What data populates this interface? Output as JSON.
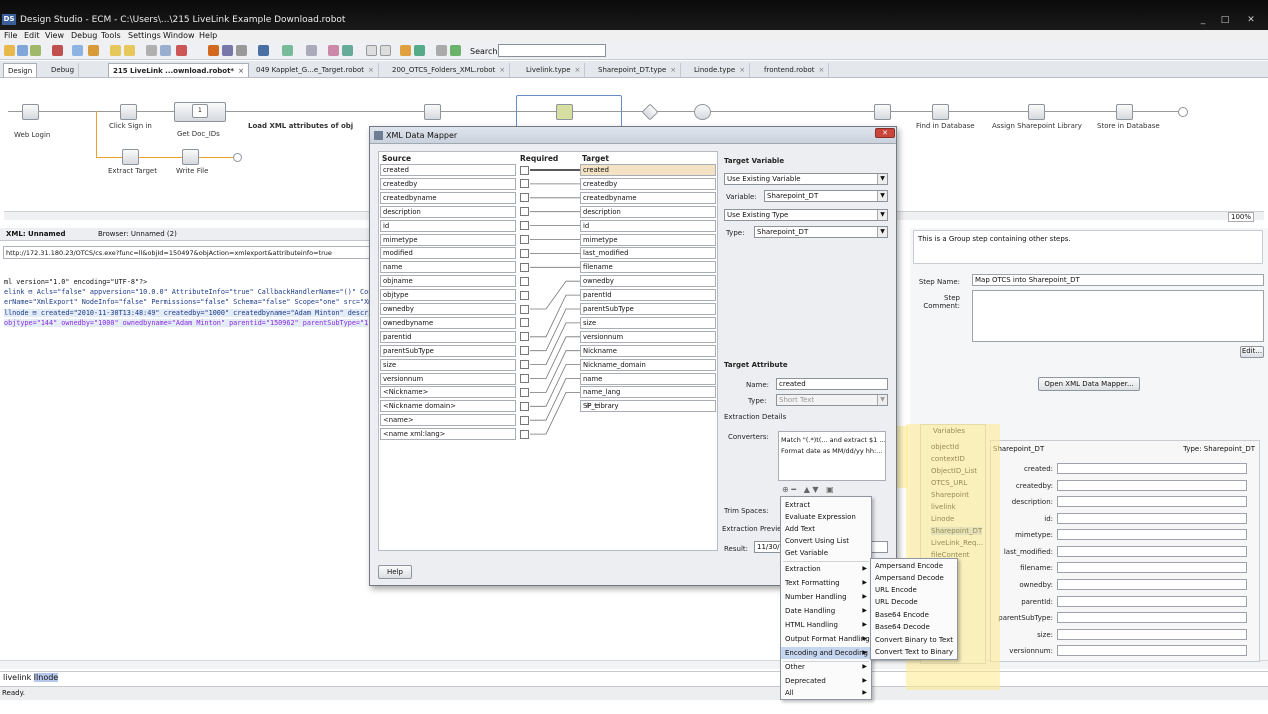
{
  "window": {
    "title": "Design Studio - ECM - C:\\Users\\...\\215 LiveLink Example Download.robot",
    "logo": "DS"
  },
  "menu": [
    "File",
    "Edit",
    "View",
    "Debug",
    "Tools",
    "Settings",
    "Window",
    "Help"
  ],
  "toolbar": {
    "search_label": "Search:",
    "search_value": ""
  },
  "tabs": {
    "mode": [
      "Design",
      "Debug"
    ],
    "docs": [
      "215 LiveLink ...ownload.robot*",
      "049 Kapplet_G...e_Target.robot",
      "200_OTCS_Folders_XML.robot",
      "Livelink.type",
      "Sharepoint_DT.type",
      "Linode.type",
      "frontend.robot"
    ]
  },
  "flow": {
    "nodes": [
      "Web Login",
      "Click Sign in",
      "Get Doc_IDs",
      "Load XML attributes of obj",
      "Find in Database",
      "Assign Sharepoint Library",
      "Store in Database",
      "Extract Target",
      "Write File"
    ],
    "loop_count": "1"
  },
  "zoom": "100%",
  "left_pane": {
    "tabs": [
      "XML: Unnamed",
      "Browser: Unnamed (2)"
    ],
    "url": "http://172.31.180.23/OTCS/cs.exe?func=ll&objId=150497&objAction=xmlexport&attributeinfo=true",
    "xml_lines": [
      "ml version=\"1.0\" encoding=\"UTF-8\"?>",
      "elink ⊟ Acls=\"false\" appversion=\"10.0.0\" AttributeInfo=\"true\" CallbackHandlerName=\"()\" ContentInline",
      "erName=\"XmlExport\" NodeInfo=\"false\" Permissions=\"false\" Schema=\"false\" Scope=\"one\" src=\"XmlE",
      "llnode ⊟ created=\"2010-11-30T13:48:49\" createdby=\"1000\" createdbyname=\"Adam Minton\" descripti",
      "objtype=\"144\" ownedby=\"1000\" ownedbyname=\"Adam Minton\" parentid=\"150962\" parentSubType=\"1"
    ],
    "path": [
      "livelink",
      "llnode"
    ]
  },
  "status": "Ready.",
  "dialog": {
    "title": "XML Data Mapper",
    "headers": {
      "source": "Source",
      "required": "Required",
      "target": "Target"
    },
    "sources": [
      "created",
      "createdby",
      "createdbyname",
      "description",
      "id",
      "mimetype",
      "modified",
      "name",
      "objname",
      "objtype",
      "ownedby",
      "ownedbyname",
      "parentid",
      "parentSubType",
      "size",
      "versionnum",
      "<Nickname>",
      "<Nickname domain>",
      "<name>",
      "<name xml:lang>"
    ],
    "targets": [
      "created",
      "createdby",
      "createdbyname",
      "description",
      "id",
      "mimetype",
      "last_modified",
      "filename",
      "ownedby",
      "parentId",
      "parentSubType",
      "size",
      "versionnum",
      "Nickname",
      "Nickname_domain",
      "name",
      "name_lang",
      "SP_Library"
    ],
    "target_variable": {
      "header": "Target Variable",
      "mode": "Use Existing Variable",
      "variable_label": "Variable:",
      "variable": "Sharepoint_DT",
      "type_mode": "Use Existing Type",
      "type_label": "Type:",
      "type": "Sharepoint_DT"
    },
    "target_attribute": {
      "header": "Target Attribute",
      "name_label": "Name:",
      "name": "created",
      "type_label": "Type:",
      "type": "Short Text"
    },
    "extraction": {
      "header": "Extraction Details",
      "converters_label": "Converters:",
      "converters": [
        "Match \"(.*)t(... and extract $1 ...",
        "Format date as MM/dd/yy hh:..."
      ],
      "trim_label": "Trim Spaces:",
      "preview_label": "Extraction Preview",
      "result_label": "Result:",
      "result": "11/30/"
    },
    "help": "Help"
  },
  "converter_menu": {
    "items": [
      "Extract",
      "Evaluate Expression",
      "Add Text",
      "Convert Using List",
      "Get Variable",
      "Extraction",
      "Text Formatting",
      "Number Handling",
      "Date Handling",
      "HTML Handling",
      "Output Format Handling",
      "Encoding and Decoding",
      "Other",
      "Deprecated",
      "All"
    ],
    "submenu": [
      "Ampersand Encode",
      "Ampersand Decode",
      "URL Encode",
      "URL Decode",
      "Base64 Encode",
      "Base64 Decode",
      "Convert Binary to Text",
      "Convert Text to Binary"
    ]
  },
  "right_panel": {
    "group_info": "This is a Group step containing other steps.",
    "step_name_label": "Step Name:",
    "step_name": "Map OTCS into Sharepoint_DT",
    "step_comment_label": "Step Comment:",
    "edit": "Edit...",
    "open_mapper": "Open XML Data Mapper...",
    "variables_header": "Variables",
    "variables": [
      "objectId",
      "contextID",
      "ObjectID_List",
      "OTCS_URL",
      "Sharepoint",
      "livelink",
      "Linode",
      "Sharepoint_DT",
      "LiveLink_Req...",
      "fileContent"
    ],
    "attr_header": "Sharepoint_DT",
    "attr_type": "Type: Sharepoint_DT",
    "attributes": [
      "created:",
      "createdby:",
      "description:",
      "id:",
      "mimetype:",
      "last_modified:",
      "filename:",
      "ownedby:",
      "parentId:",
      "parentSubType:",
      "size:",
      "versionnum:"
    ]
  },
  "colors": {
    "highlight": "#ffe98c",
    "selection": "#b7c9ea",
    "tab_active": "#ffffff"
  }
}
